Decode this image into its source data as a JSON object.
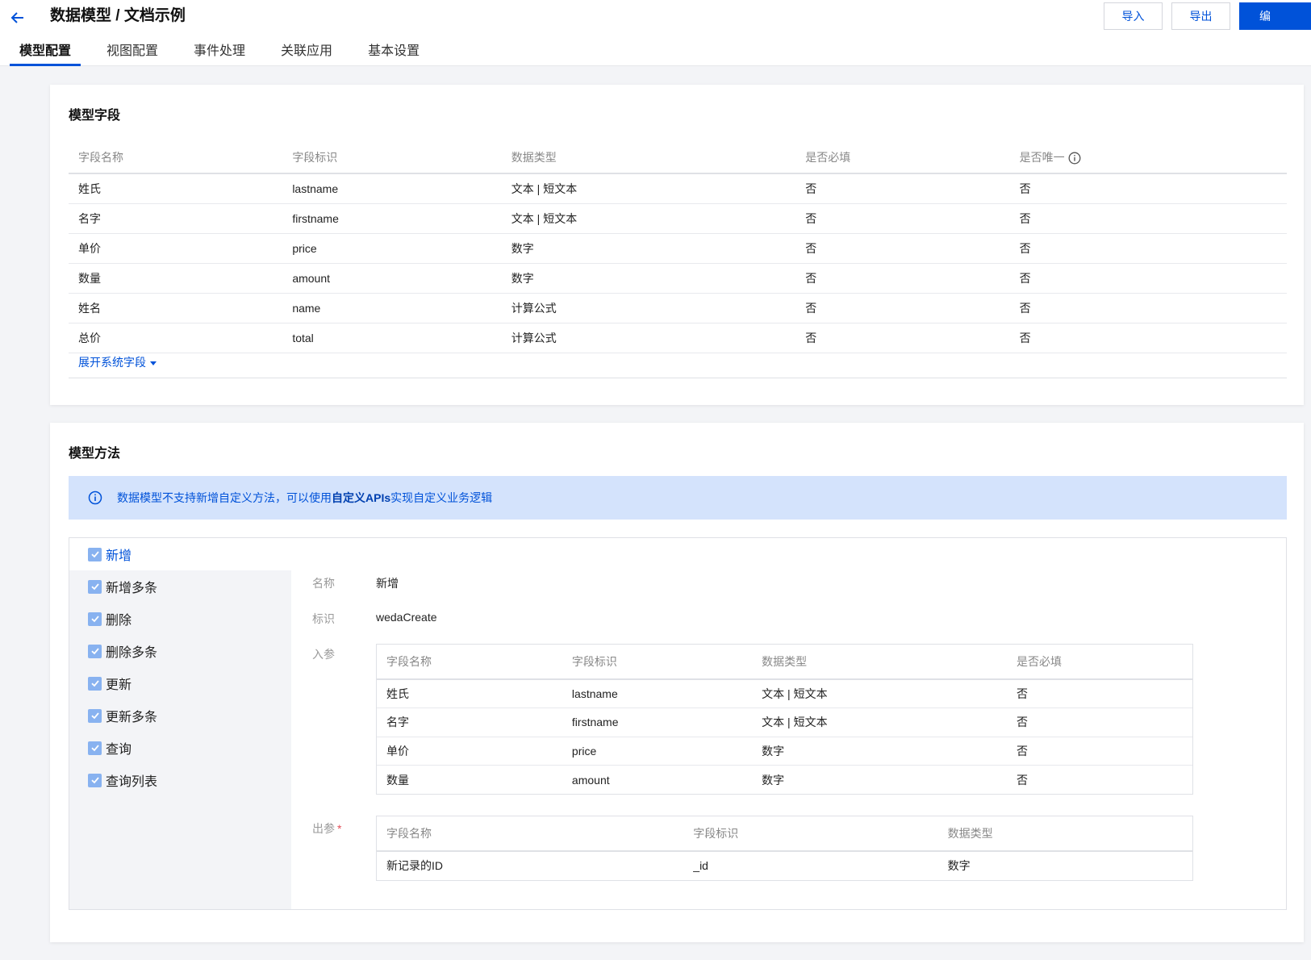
{
  "header": {
    "title": "数据模型 / 文档示例",
    "import_label": "导入",
    "export_label": "导出",
    "edit_label": "编"
  },
  "tabs": [
    {
      "label": "模型配置",
      "active": true
    },
    {
      "label": "视图配置",
      "active": false
    },
    {
      "label": "事件处理",
      "active": false
    },
    {
      "label": "关联应用",
      "active": false
    },
    {
      "label": "基本设置",
      "active": false
    }
  ],
  "fields_card": {
    "title": "模型字段",
    "columns": [
      "字段名称",
      "字段标识",
      "数据类型",
      "是否必填",
      "是否唯一"
    ],
    "rows": [
      [
        "姓氏",
        "lastname",
        "文本 | 短文本",
        "否",
        "否"
      ],
      [
        "名字",
        "firstname",
        "文本 | 短文本",
        "否",
        "否"
      ],
      [
        "单价",
        "price",
        "数字",
        "否",
        "否"
      ],
      [
        "数量",
        "amount",
        "数字",
        "否",
        "否"
      ],
      [
        "姓名",
        "name",
        "计算公式",
        "否",
        "否"
      ],
      [
        "总价",
        "total",
        "计算公式",
        "否",
        "否"
      ]
    ],
    "expand_label": "展开系统字段"
  },
  "methods_card": {
    "title": "模型方法",
    "notice_prefix": "数据模型不支持新增自定义方法，可以使用",
    "notice_link": "自定义APIs",
    "notice_suffix": "实现自定义业务逻辑",
    "methods": [
      {
        "label": "新增",
        "checked": true,
        "active": true
      },
      {
        "label": "新增多条",
        "checked": true,
        "active": false
      },
      {
        "label": "删除",
        "checked": true,
        "active": false
      },
      {
        "label": "删除多条",
        "checked": true,
        "active": false
      },
      {
        "label": "更新",
        "checked": true,
        "active": false
      },
      {
        "label": "更新多条",
        "checked": true,
        "active": false
      },
      {
        "label": "查询",
        "checked": true,
        "active": false
      },
      {
        "label": "查询列表",
        "checked": true,
        "active": false
      }
    ],
    "detail": {
      "name_label": "名称",
      "name_value": "新增",
      "id_label": "标识",
      "id_value": "wedaCreate",
      "input_label": "入参",
      "input_columns": [
        "字段名称",
        "字段标识",
        "数据类型",
        "是否必填"
      ],
      "input_rows": [
        [
          "姓氏",
          "lastname",
          "文本 | 短文本",
          "否"
        ],
        [
          "名字",
          "firstname",
          "文本 | 短文本",
          "否"
        ],
        [
          "单价",
          "price",
          "数字",
          "否"
        ],
        [
          "数量",
          "amount",
          "数字",
          "否"
        ]
      ],
      "output_label": "出参",
      "output_required_mark": "*",
      "output_columns": [
        "字段名称",
        "字段标识",
        "数据类型"
      ],
      "output_rows": [
        [
          "新记录的ID",
          "_id",
          "数字"
        ]
      ]
    }
  },
  "colors": {
    "accent": "#0052d9",
    "notice_bg": "#d4e3fc",
    "checkbox": "#88b2f0",
    "page_bg": "#f3f4f7"
  },
  "icons": {
    "back": "arrow-left-icon",
    "info": "info-circle-icon",
    "expand": "caret-down-icon",
    "check": "check-icon"
  }
}
